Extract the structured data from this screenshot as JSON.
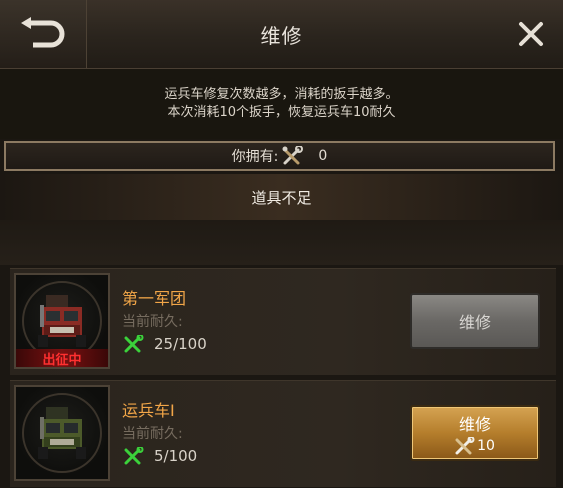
{
  "header": {
    "title": "维修",
    "back_icon": "back-arrow-icon",
    "close_icon": "close-icon"
  },
  "info": {
    "line1": "运兵车修复次数越多，消耗的扳手越多。",
    "line2": "本次消耗10个扳手，恢复运兵车10耐久"
  },
  "owned": {
    "label": "你拥有:",
    "count": "0",
    "icon": "wrench-icon"
  },
  "insufficient_text": "道具不足",
  "units": [
    {
      "name": "第一军团",
      "durability_label": "当前耐久:",
      "durability": "25/100",
      "status_tag": "出征中",
      "repair_label": "维修",
      "repair_enabled": false
    },
    {
      "name": "运兵车I",
      "durability_label": "当前耐久:",
      "durability": "5/100",
      "repair_label": "维修",
      "repair_cost": "10",
      "repair_enabled": true
    }
  ],
  "colors": {
    "accent_orange": "#f2a648",
    "status_red": "#ff3030",
    "durability_green": "#3bd23b",
    "button_gold": "#b57e2c"
  }
}
